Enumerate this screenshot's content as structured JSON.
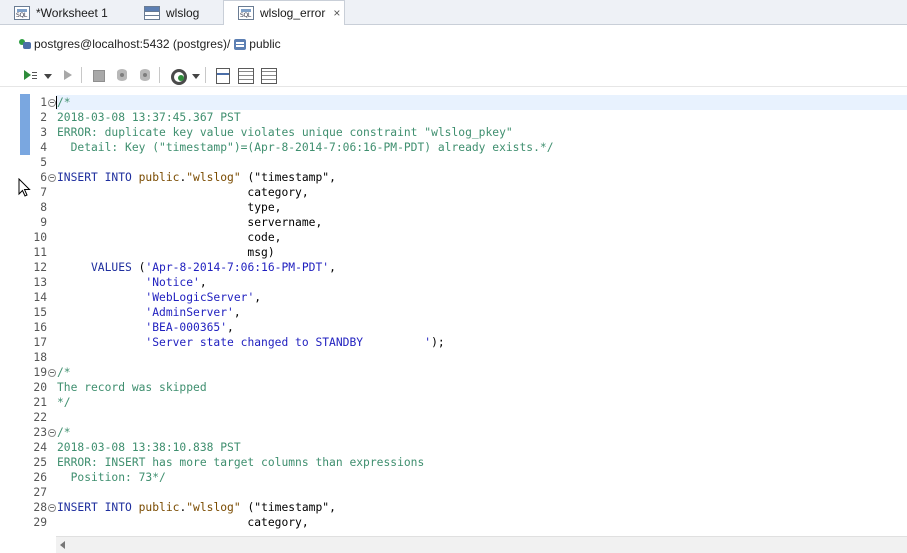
{
  "tabs": [
    {
      "label": "*Worksheet 1",
      "icon": "sql-file-icon",
      "active": false
    },
    {
      "label": "wlslog",
      "icon": "table-icon",
      "active": false
    },
    {
      "label": "wlslog_error",
      "icon": "sql-file-icon",
      "active": true,
      "close": "×"
    }
  ],
  "connection": {
    "label": "postgres@localhost:5432 (postgres)",
    "separator": "/",
    "schema": "public"
  },
  "toolbar": {
    "icons": [
      "run-statement-icon",
      "dropdown-icon",
      "run-script-icon",
      "stop-icon",
      "commit-icon",
      "rollback-icon",
      "transaction-icon",
      "dropdown-icon",
      "editor-layout-icon",
      "results-panel-icon",
      "output-panel-icon"
    ]
  },
  "editor": {
    "lines": [
      {
        "n": "1",
        "fold": true,
        "parts": [
          {
            "t": "/*",
            "c": "cm"
          }
        ]
      },
      {
        "n": "2",
        "parts": [
          {
            "t": "2018-03-08 13:37:45.367 PST",
            "c": "cm"
          }
        ]
      },
      {
        "n": "3",
        "parts": [
          {
            "t": "ERROR: duplicate key value violates unique constraint \"wlslog_pkey\"",
            "c": "cm"
          }
        ]
      },
      {
        "n": "4",
        "parts": [
          {
            "t": "  Detail: Key (\"timestamp\")=(Apr-8-2014-7:06:16-PM-PDT) already exists.*/",
            "c": "cm"
          }
        ]
      },
      {
        "n": "5",
        "parts": []
      },
      {
        "n": "6",
        "fold": true,
        "parts": [
          {
            "t": "INSERT INTO ",
            "c": "kw"
          },
          {
            "t": "public",
            "c": "sc"
          },
          {
            "t": ".",
            "c": "pl"
          },
          {
            "t": "\"wlslog\"",
            "c": "sc"
          },
          {
            "t": " (\"timestamp\",",
            "c": "pl"
          }
        ]
      },
      {
        "n": "7",
        "parts": [
          {
            "t": "                            category,",
            "c": "pl"
          }
        ]
      },
      {
        "n": "8",
        "parts": [
          {
            "t": "                            type,",
            "c": "pl"
          }
        ]
      },
      {
        "n": "9",
        "parts": [
          {
            "t": "                            servername,",
            "c": "pl"
          }
        ]
      },
      {
        "n": "10",
        "parts": [
          {
            "t": "                            code,",
            "c": "pl"
          }
        ]
      },
      {
        "n": "11",
        "parts": [
          {
            "t": "                            msg)",
            "c": "pl"
          }
        ]
      },
      {
        "n": "12",
        "parts": [
          {
            "t": "     VALUES ",
            "c": "kw"
          },
          {
            "t": "(",
            "c": "pl"
          },
          {
            "t": "'Apr-8-2014-7:06:16-PM-PDT'",
            "c": "st"
          },
          {
            "t": ",",
            "c": "pl"
          }
        ]
      },
      {
        "n": "13",
        "parts": [
          {
            "t": "             ",
            "c": "pl"
          },
          {
            "t": "'Notice'",
            "c": "st"
          },
          {
            "t": ",",
            "c": "pl"
          }
        ]
      },
      {
        "n": "14",
        "parts": [
          {
            "t": "             ",
            "c": "pl"
          },
          {
            "t": "'WebLogicServer'",
            "c": "st"
          },
          {
            "t": ",",
            "c": "pl"
          }
        ]
      },
      {
        "n": "15",
        "parts": [
          {
            "t": "             ",
            "c": "pl"
          },
          {
            "t": "'AdminServer'",
            "c": "st"
          },
          {
            "t": ",",
            "c": "pl"
          }
        ]
      },
      {
        "n": "16",
        "parts": [
          {
            "t": "             ",
            "c": "pl"
          },
          {
            "t": "'BEA-000365'",
            "c": "st"
          },
          {
            "t": ",",
            "c": "pl"
          }
        ]
      },
      {
        "n": "17",
        "parts": [
          {
            "t": "             ",
            "c": "pl"
          },
          {
            "t": "'Server state changed to STANDBY         '",
            "c": "st"
          },
          {
            "t": ");",
            "c": "pl"
          }
        ]
      },
      {
        "n": "18",
        "parts": []
      },
      {
        "n": "19",
        "fold": true,
        "parts": [
          {
            "t": "/*",
            "c": "cm"
          }
        ]
      },
      {
        "n": "20",
        "parts": [
          {
            "t": "The record was skipped",
            "c": "cm"
          }
        ]
      },
      {
        "n": "21",
        "parts": [
          {
            "t": "*/",
            "c": "cm"
          }
        ]
      },
      {
        "n": "22",
        "parts": []
      },
      {
        "n": "23",
        "fold": true,
        "parts": [
          {
            "t": "/*",
            "c": "cm"
          }
        ]
      },
      {
        "n": "24",
        "parts": [
          {
            "t": "2018-03-08 13:38:10.838 PST",
            "c": "cm"
          }
        ]
      },
      {
        "n": "25",
        "parts": [
          {
            "t": "ERROR: INSERT has more target columns than expressions",
            "c": "cm"
          }
        ]
      },
      {
        "n": "26",
        "parts": [
          {
            "t": "  Position: 73*/",
            "c": "cm"
          }
        ]
      },
      {
        "n": "27",
        "parts": []
      },
      {
        "n": "28",
        "fold": true,
        "parts": [
          {
            "t": "INSERT INTO ",
            "c": "kw"
          },
          {
            "t": "public",
            "c": "sc"
          },
          {
            "t": ".",
            "c": "pl"
          },
          {
            "t": "\"wlslog\"",
            "c": "sc"
          },
          {
            "t": " (\"timestamp\",",
            "c": "pl"
          }
        ]
      },
      {
        "n": "29",
        "parts": [
          {
            "t": "                            category,",
            "c": "pl"
          }
        ]
      }
    ]
  },
  "colors": {
    "comment": "#3f8f6f",
    "keyword": "#1e2e9e",
    "identifier": "#7a4b00",
    "string": "#1f1fbf",
    "current_line": "#e8f2fe",
    "ruler_band": "#7aa7e0"
  }
}
